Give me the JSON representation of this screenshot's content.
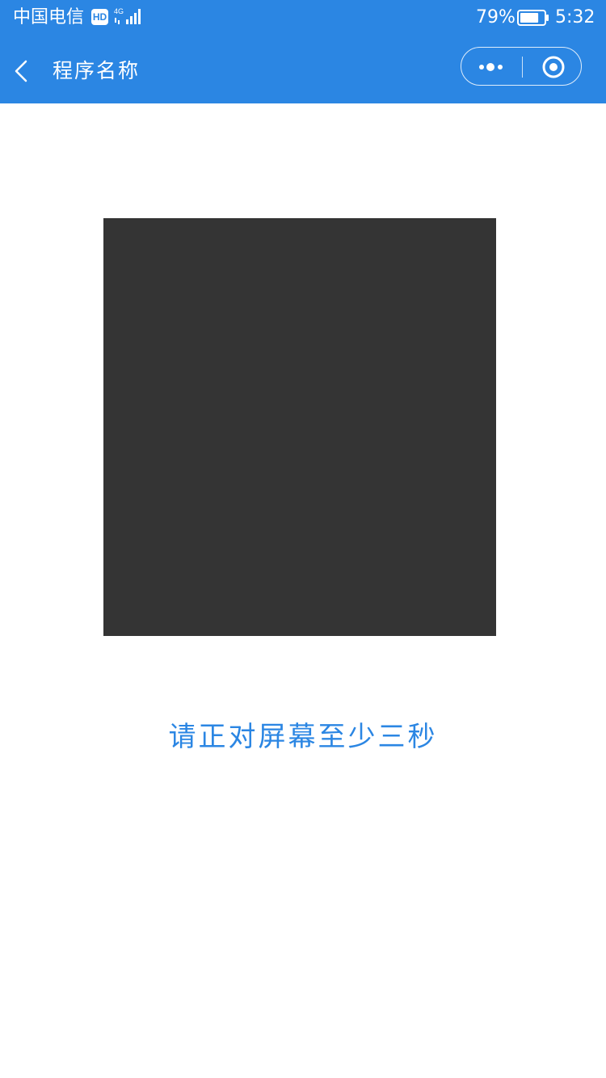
{
  "status_bar": {
    "carrier": "中国电信",
    "hd_badge": "HD",
    "network_type": "4G",
    "battery_percent": "79%",
    "battery_level": 0.79,
    "time": "5:32"
  },
  "nav": {
    "title": "程序名称",
    "back_icon": "chevron-left-icon",
    "more_icon": "more-dots-icon",
    "close_icon": "target-close-icon"
  },
  "main": {
    "instruction": "请正对屏幕至少三秒"
  },
  "colors": {
    "header_bg": "#2b86e3",
    "accent_text": "#2b86e3",
    "camera_bg": "#343434",
    "page_bg": "#ffffff"
  }
}
